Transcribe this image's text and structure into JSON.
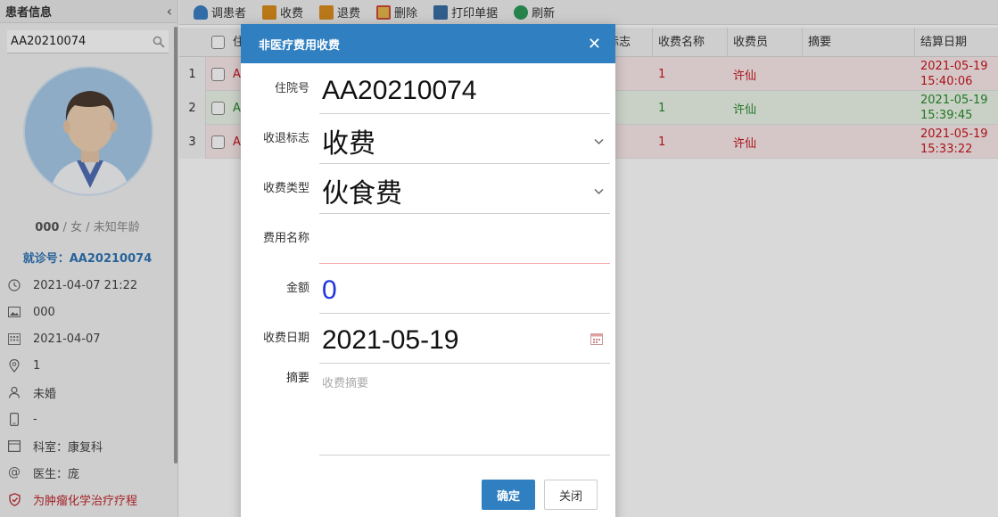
{
  "left_panel": {
    "title": "患者信息",
    "collapse_icon": "chevron-left-icon",
    "search_value": "AA20210074",
    "patient_summary": {
      "name": "000",
      "rest": " / 女 / 未知年龄"
    },
    "visit_no": "就诊号：AA20210074",
    "info": [
      {
        "icon": "clock-icon",
        "text": "2021-04-07 21:22"
      },
      {
        "icon": "image-icon",
        "text": "000"
      },
      {
        "icon": "calendar-grid-icon",
        "text": "2021-04-07"
      },
      {
        "icon": "location-pin-icon",
        "text": "1"
      },
      {
        "icon": "person-icon",
        "text": "未婚"
      },
      {
        "icon": "phone-icon",
        "text": "-"
      },
      {
        "icon": "department-icon",
        "text": "科室：康复科"
      },
      {
        "icon": "at-icon",
        "text": "医生：庞"
      },
      {
        "icon": "shield-icon",
        "text": "为肿瘤化学治疗疗程"
      }
    ]
  },
  "toolbar": {
    "buttons": [
      {
        "label": "调患者",
        "icon": "patient-icon",
        "color": "#3b7fc4"
      },
      {
        "label": "收费",
        "icon": "charge-icon",
        "color": "#d98d1e"
      },
      {
        "label": "退费",
        "icon": "refund-icon",
        "color": "#d98d1e"
      },
      {
        "label": "删除",
        "icon": "delete-icon",
        "color": "#d04a3a"
      },
      {
        "label": "打印单据",
        "icon": "print-icon",
        "color": "#3a6ea5"
      },
      {
        "label": "刷新",
        "icon": "refresh-icon",
        "color": "#2e9a5a"
      }
    ]
  },
  "grid": {
    "headers": {
      "col_partial": "住",
      "flag_partial": "标志",
      "charge_name": "收费名称",
      "cashier": "收费员",
      "summary": "摘要",
      "settle_date": "结算日期"
    },
    "rows": [
      {
        "num": "1",
        "partial": "A",
        "charge_name": "1",
        "cashier": "许仙",
        "date1": "2021-05-19",
        "date2": "15:40:06",
        "status": "red"
      },
      {
        "num": "2",
        "partial": "A",
        "charge_name": "1",
        "cashier": "许仙",
        "date1": "2021-05-19",
        "date2": "15:39:45",
        "status": "green"
      },
      {
        "num": "3",
        "partial": "A",
        "charge_name": "1",
        "cashier": "许仙",
        "date1": "2021-05-19",
        "date2": "15:33:22",
        "status": "red"
      }
    ]
  },
  "dialog": {
    "title": "非医疗费用收费",
    "fields": {
      "admission_no": {
        "label": "住院号",
        "value": "AA20210074"
      },
      "charge_flag": {
        "label": "收退标志",
        "value": "收费"
      },
      "charge_type": {
        "label": "收费类型",
        "value": "伙食费"
      },
      "fee_name": {
        "label": "费用名称",
        "value": ""
      },
      "amount": {
        "label": "金额",
        "value": "0"
      },
      "charge_date": {
        "label": "收费日期",
        "value": "2021-05-19"
      },
      "summary": {
        "label": "摘要",
        "placeholder": "收费摘要"
      }
    },
    "ok_label": "确定",
    "close_label": "关闭"
  },
  "colors": {
    "primary": "#2f7fc1",
    "red": "#c8161e",
    "green": "#2a8a2a",
    "blue_value": "#1d34e0"
  }
}
